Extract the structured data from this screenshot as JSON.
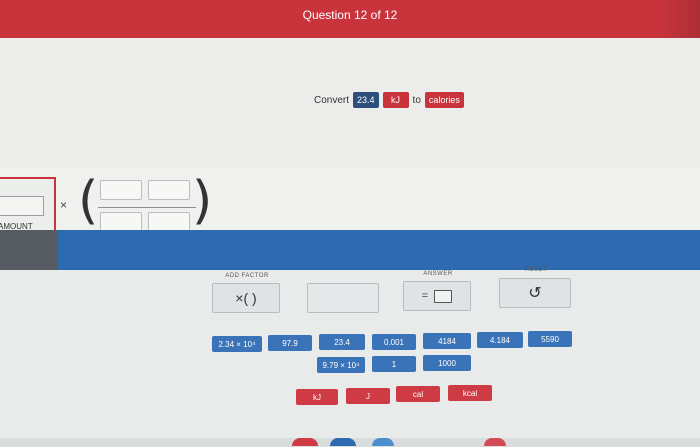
{
  "header": {
    "title": "Question 12 of 12"
  },
  "prompt": {
    "convert_word": "Convert",
    "value": "23.4",
    "unit": "kJ",
    "to_word": "to",
    "target_unit": "calories"
  },
  "workspace": {
    "amount_label": "AMOUNT",
    "multiply_sign": "×",
    "open_paren": "(",
    "close_paren": ")"
  },
  "tools": {
    "add_factor_label": "ADD FACTOR",
    "add_factor_glyph": "×( )",
    "answer_label": "ANSWER",
    "answer_eq": "=",
    "reset_label": "RESET",
    "reset_glyph": "↺"
  },
  "tiles": {
    "row1": [
      "2.34 × 10⁴",
      "97.9",
      "23.4",
      "0.001",
      "4184",
      "4.184",
      "5590"
    ],
    "row2": [
      "9.79 × 10⁴",
      "1",
      "1000"
    ],
    "units": [
      "kJ",
      "J",
      "cal",
      "kcal"
    ]
  },
  "colors": {
    "accent_red": "#c8333c",
    "accent_blue": "#2d6ab0",
    "tile_blue": "#3a73b7",
    "tile_red": "#cf3b45"
  }
}
